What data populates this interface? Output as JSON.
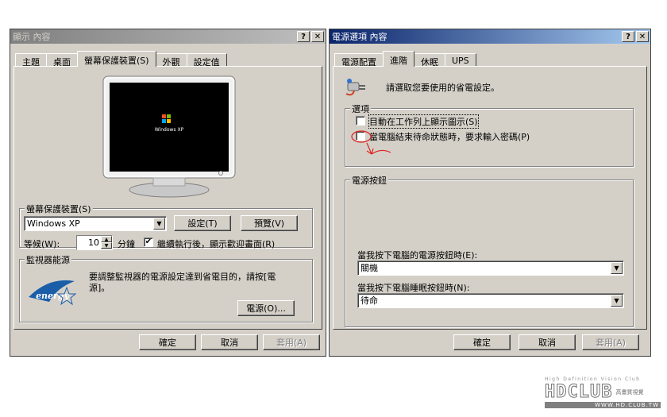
{
  "left_window": {
    "title": "顯示 內容",
    "help_btn": "?",
    "close_btn": "✕",
    "tabs": [
      {
        "label": "主題"
      },
      {
        "label": "桌面"
      },
      {
        "label": "螢幕保護裝置(S)",
        "selected": true
      },
      {
        "label": "外觀"
      },
      {
        "label": "設定值"
      }
    ],
    "preview_text": "Windows XP",
    "screensaver": {
      "group_label": "螢幕保護裝置(S)",
      "selected": "Windows XP",
      "settings_btn": "設定(T)",
      "preview_btn": "預覽(V)",
      "wait_label": "等候(W):",
      "wait_value": "10",
      "minutes_label": "分鐘",
      "resume_checked": true,
      "resume_label": "繼續執行後，顯示歡迎畫面(R)"
    },
    "monitor_power": {
      "group_label": "監視器能源",
      "text": "要調整監視器的電源設定達到省電目的，請按[電源]。",
      "power_btn": "電源(O)...",
      "energy_logo": "energy"
    },
    "buttons": {
      "ok": "確定",
      "cancel": "取消",
      "apply": "套用(A)"
    }
  },
  "right_window": {
    "title": "電源選項 內容",
    "help_btn": "?",
    "close_btn": "✕",
    "tabs": [
      {
        "label": "電源配置"
      },
      {
        "label": "進階",
        "selected": true
      },
      {
        "label": "休眠"
      },
      {
        "label": "UPS"
      }
    ],
    "intro": "請選取您要使用的省電設定。",
    "options": {
      "group_label": "選項",
      "show_icon_label": "目動在工作列上顯示圖示(S)",
      "show_icon_checked": false,
      "password_label": "當電腦結束待命狀態時，要求輸入密碼(P)",
      "password_checked": false
    },
    "power_buttons": {
      "group_label": "電源按鈕",
      "power_label": "當我按下電腦的電源按鈕時(E):",
      "power_value": "關機",
      "sleep_label": "當我按下電腦睡眠按鈕時(N):",
      "sleep_value": "待命"
    },
    "buttons": {
      "ok": "確定",
      "cancel": "取消",
      "apply": "套用(A)"
    }
  },
  "watermark": {
    "tagline": "High Definition Vision Club",
    "logo": "HDCLUB",
    "cn": "高畫質視覺",
    "url": "WWW.HD.CLUB.TW"
  },
  "colors": {
    "face": "#d4d0c8",
    "active_title": "#0a246a",
    "annotation": "#e02020"
  }
}
